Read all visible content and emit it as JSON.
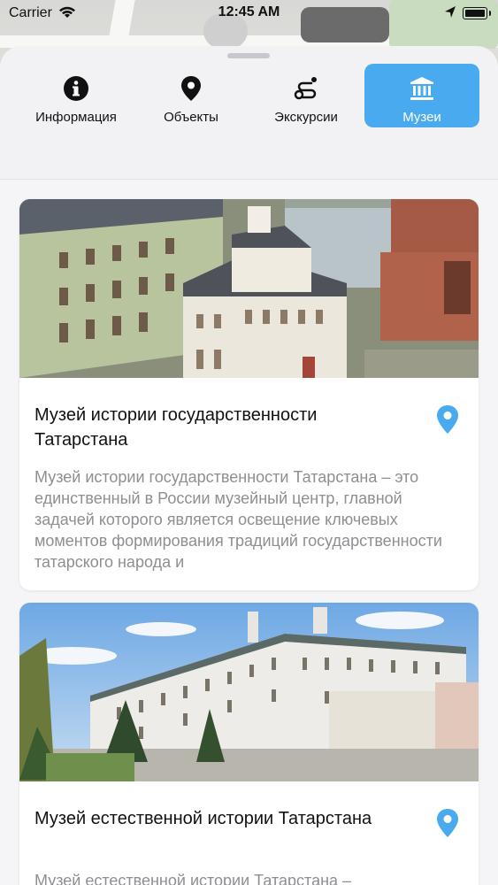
{
  "status_bar": {
    "carrier": "Carrier",
    "time": "12:45 AM"
  },
  "tabs": [
    {
      "label": "Информация",
      "icon": "info-icon",
      "active": false
    },
    {
      "label": "Объекты",
      "icon": "location-pin-icon",
      "active": false
    },
    {
      "label": "Экскурсии",
      "icon": "route-icon",
      "active": false
    },
    {
      "label": "Музеи",
      "icon": "museum-icon",
      "active": true
    }
  ],
  "museums": [
    {
      "title": "Музей истории государственности Татарстана",
      "description": "Музей истории государственности Татарстана – это единственный в России музейный центр, главной задачей которого является освещение ключевых моментов формирования традиций государственности татарского народа и",
      "image": "kremlin-buildings-photo"
    },
    {
      "title": "Музей естественной истории Татарстана",
      "description": "Музей естественной истории Татарстана –",
      "image": "long-white-building-photo"
    }
  ],
  "colors": {
    "accent": "#4aaaf0",
    "pin": "#4aaaf0",
    "text": "#111111",
    "muted": "#8e8e93"
  }
}
